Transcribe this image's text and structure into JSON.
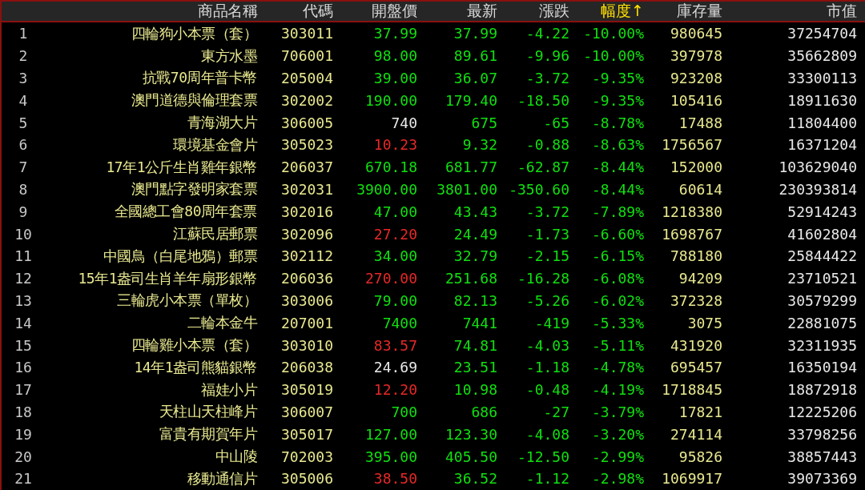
{
  "columns": [
    {
      "label": "商品名稱",
      "sorted": false
    },
    {
      "label": "代碼",
      "sorted": false
    },
    {
      "label": "開盤價",
      "sorted": false
    },
    {
      "label": "最新",
      "sorted": false
    },
    {
      "label": "漲跌",
      "sorted": false
    },
    {
      "label": "幅度↑",
      "sorted": true
    },
    {
      "label": "庫存量",
      "sorted": false
    },
    {
      "label": "市值",
      "sorted": false
    }
  ],
  "rows": [
    {
      "index": "1",
      "name": "四輪狗小本票（套）",
      "code": "303011",
      "open": {
        "text": "37.99",
        "color": "#10e010"
      },
      "latest": "37.99",
      "change": "-4.22",
      "pct": "-10.00%",
      "stock": "980645",
      "value": "37254704"
    },
    {
      "index": "2",
      "name": "東方水墨",
      "code": "706001",
      "open": {
        "text": "98.00",
        "color": "#10e010"
      },
      "latest": "89.61",
      "change": "-9.96",
      "pct": "-10.00%",
      "stock": "397978",
      "value": "35662809"
    },
    {
      "index": "3",
      "name": "抗戰70周年普卡幣",
      "code": "205004",
      "open": {
        "text": "39.00",
        "color": "#10e010"
      },
      "latest": "36.07",
      "change": "-3.72",
      "pct": "-9.35%",
      "stock": "923208",
      "value": "33300113"
    },
    {
      "index": "4",
      "name": "澳門道德與倫理套票",
      "code": "302002",
      "open": {
        "text": "190.00",
        "color": "#10e010"
      },
      "latest": "179.40",
      "change": "-18.50",
      "pct": "-9.35%",
      "stock": "105416",
      "value": "18911630"
    },
    {
      "index": "5",
      "name": "青海湖大片",
      "code": "306005",
      "open": {
        "text": "740",
        "color": "#e8e8e8"
      },
      "latest": "675",
      "change": "-65",
      "pct": "-8.78%",
      "stock": "17488",
      "value": "11804400"
    },
    {
      "index": "6",
      "name": "環境基金會片",
      "code": "305023",
      "open": {
        "text": "10.23",
        "color": "#e82828"
      },
      "latest": "9.32",
      "change": "-0.88",
      "pct": "-8.63%",
      "stock": "1756567",
      "value": "16371204"
    },
    {
      "index": "7",
      "name": "17年1公斤生肖雞年銀幣",
      "code": "206037",
      "open": {
        "text": "670.18",
        "color": "#10e010"
      },
      "latest": "681.77",
      "change": "-62.87",
      "pct": "-8.44%",
      "stock": "152000",
      "value": "103629040"
    },
    {
      "index": "8",
      "name": "澳門點字發明家套票",
      "code": "302031",
      "open": {
        "text": "3900.00",
        "color": "#10e010"
      },
      "latest": "3801.00",
      "change": "-350.60",
      "pct": "-8.44%",
      "stock": "60614",
      "value": "230393814"
    },
    {
      "index": "9",
      "name": "全國總工會80周年套票",
      "code": "302016",
      "open": {
        "text": "47.00",
        "color": "#10e010"
      },
      "latest": "43.43",
      "change": "-3.72",
      "pct": "-7.89%",
      "stock": "1218380",
      "value": "52914243"
    },
    {
      "index": "10",
      "name": "江蘇民居郵票",
      "code": "302096",
      "open": {
        "text": "27.20",
        "color": "#e82828"
      },
      "latest": "24.49",
      "change": "-1.73",
      "pct": "-6.60%",
      "stock": "1698767",
      "value": "41602804"
    },
    {
      "index": "11",
      "name": "中國鳥（白尾地鴉）郵票",
      "code": "302112",
      "open": {
        "text": "34.00",
        "color": "#10e010"
      },
      "latest": "32.79",
      "change": "-2.15",
      "pct": "-6.15%",
      "stock": "788180",
      "value": "25844422"
    },
    {
      "index": "12",
      "name": "15年1盎司生肖羊年扇形銀幣",
      "code": "206036",
      "open": {
        "text": "270.00",
        "color": "#e82828"
      },
      "latest": "251.68",
      "change": "-16.28",
      "pct": "-6.08%",
      "stock": "94209",
      "value": "23710521"
    },
    {
      "index": "13",
      "name": "三輪虎小本票（單枚）",
      "code": "303006",
      "open": {
        "text": "79.00",
        "color": "#10e010"
      },
      "latest": "82.13",
      "change": "-5.26",
      "pct": "-6.02%",
      "stock": "372328",
      "value": "30579299"
    },
    {
      "index": "14",
      "name": "二輪本金牛",
      "code": "207001",
      "open": {
        "text": "7400",
        "color": "#10e010"
      },
      "latest": "7441",
      "change": "-419",
      "pct": "-5.33%",
      "stock": "3075",
      "value": "22881075"
    },
    {
      "index": "15",
      "name": "四輪雞小本票（套）",
      "code": "303010",
      "open": {
        "text": "83.57",
        "color": "#e82828"
      },
      "latest": "74.81",
      "change": "-4.03",
      "pct": "-5.11%",
      "stock": "431920",
      "value": "32311935"
    },
    {
      "index": "16",
      "name": "14年1盎司熊貓銀幣",
      "code": "206038",
      "open": {
        "text": "24.69",
        "color": "#e8e8e8"
      },
      "latest": "23.51",
      "change": "-1.18",
      "pct": "-4.78%",
      "stock": "695457",
      "value": "16350194"
    },
    {
      "index": "17",
      "name": "福娃小片",
      "code": "305019",
      "open": {
        "text": "12.20",
        "color": "#e82828"
      },
      "latest": "10.98",
      "change": "-0.48",
      "pct": "-4.19%",
      "stock": "1718845",
      "value": "18872918"
    },
    {
      "index": "18",
      "name": "天柱山天柱峰片",
      "code": "306007",
      "open": {
        "text": "700",
        "color": "#10e010"
      },
      "latest": "686",
      "change": "-27",
      "pct": "-3.79%",
      "stock": "17821",
      "value": "12225206"
    },
    {
      "index": "19",
      "name": "富貴有期賀年片",
      "code": "305017",
      "open": {
        "text": "127.00",
        "color": "#10e010"
      },
      "latest": "123.30",
      "change": "-4.08",
      "pct": "-3.20%",
      "stock": "274114",
      "value": "33798256"
    },
    {
      "index": "20",
      "name": "中山陵",
      "code": "702003",
      "open": {
        "text": "395.00",
        "color": "#10e010"
      },
      "latest": "405.50",
      "change": "-12.50",
      "pct": "-2.99%",
      "stock": "95826",
      "value": "38857443"
    },
    {
      "index": "21",
      "name": "移動通信片",
      "code": "305006",
      "open": {
        "text": "38.50",
        "color": "#e82828"
      },
      "latest": "36.52",
      "change": "-1.12",
      "pct": "-2.98%",
      "stock": "1069917",
      "value": "39073369"
    }
  ]
}
